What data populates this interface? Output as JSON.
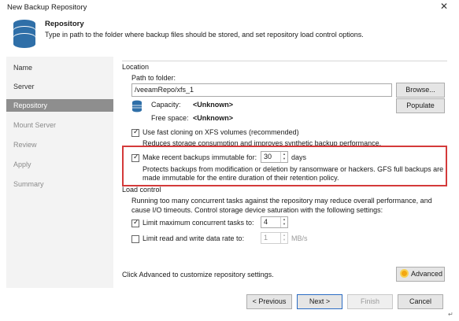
{
  "window": {
    "title": "New Backup Repository",
    "close_glyph": "✕"
  },
  "header": {
    "title": "Repository",
    "description": "Type in path to the folder where backup files should be stored, and set repository load control options.",
    "icon": "database-icon"
  },
  "sidebar": {
    "items": [
      {
        "label": "Name",
        "state": "normal"
      },
      {
        "label": "Server",
        "state": "normal"
      },
      {
        "label": "Repository",
        "state": "active"
      },
      {
        "label": "Mount Server",
        "state": "dim"
      },
      {
        "label": "Review",
        "state": "dim"
      },
      {
        "label": "Apply",
        "state": "dim"
      },
      {
        "label": "Summary",
        "state": "dim"
      }
    ]
  },
  "location": {
    "section_label": "Location",
    "path_label": "Path to folder:",
    "path_value": "/veeamRepo/xfs_1",
    "browse_label": "Browse...",
    "capacity_label": "Capacity:",
    "capacity_value": "<Unknown>",
    "free_space_label": "Free space:",
    "free_space_value": "<Unknown>",
    "populate_label": "Populate",
    "fast_cloning_label": "Use fast cloning on XFS volumes (recommended)",
    "fast_cloning_checked": true,
    "fast_cloning_desc": "Reduces storage consumption and improves synthetic backup performance.",
    "immutable_label": "Make recent backups immutable for:",
    "immutable_checked": true,
    "immutable_days": "30",
    "immutable_unit": "days",
    "immutable_desc_line1": "Protects backups from modification or deletion by ransomware or hackers. GFS full backups are",
    "immutable_desc_line2": "made immutable for the entire duration of their retention policy."
  },
  "load_control": {
    "section_label": "Load control",
    "desc_line1": "Running too many concurrent tasks against the repository may reduce overall performance, and",
    "desc_line2": "cause I/O timeouts. Control storage device saturation with the following settings:",
    "limit_tasks_label": "Limit maximum concurrent tasks to:",
    "limit_tasks_checked": true,
    "limit_tasks_value": "4",
    "limit_rate_label": "Limit read and write data rate to:",
    "limit_rate_checked": false,
    "limit_rate_value": "1",
    "limit_rate_unit": "MB/s"
  },
  "advanced": {
    "hint": "Click Advanced to customize repository settings.",
    "button_label": "Advanced",
    "icon": "sun-icon"
  },
  "footer": {
    "previous_label": "< Previous",
    "next_label": "Next >",
    "finish_label": "Finish",
    "cancel_label": "Cancel"
  },
  "colors": {
    "highlight_border": "#d43a3a",
    "active_nav": "#8e8e8e",
    "primary_border": "#2b6cc4"
  }
}
